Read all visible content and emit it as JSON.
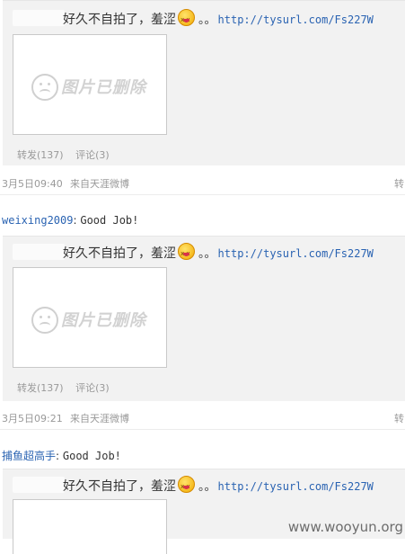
{
  "post_text": "好久不自拍了，羞涩",
  "dots": "。。",
  "link": "http://tysurl.com/Fs227W",
  "deleted_image_text": "图片已删除",
  "forward_label": "转发(137)",
  "comment_label": "评论(3)",
  "posts": [
    {
      "time": "3月5日09:40",
      "source": "来自天涯微博",
      "forward_short": "转"
    },
    {
      "time": "3月5日09:21",
      "source": "来自天涯微博",
      "forward_short": "转"
    }
  ],
  "comments": [
    {
      "user": "weixing2009",
      "message": "Good Job!"
    },
    {
      "user": "捕鱼超高手",
      "message": "Good Job!"
    }
  ],
  "watermark": "www.wooyun.org"
}
